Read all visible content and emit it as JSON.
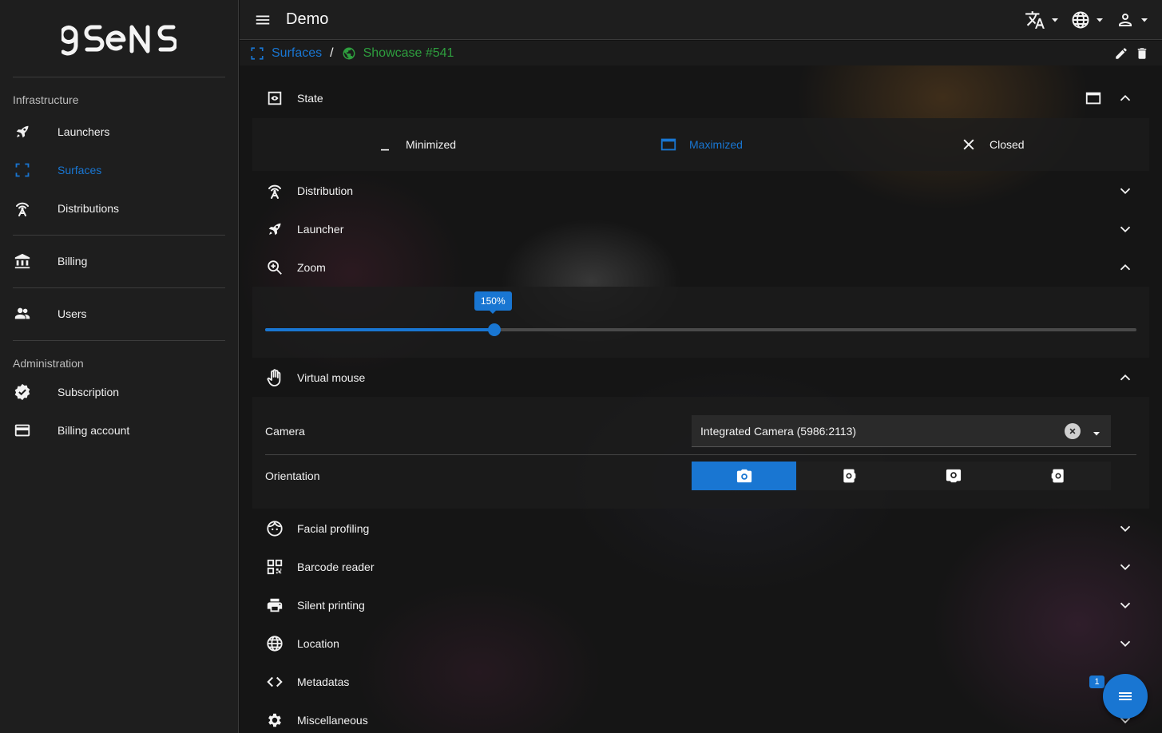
{
  "app": {
    "logo_text": "9sens",
    "title": "Demo"
  },
  "sidebar": {
    "sections": [
      {
        "label": "Infrastructure",
        "items": [
          {
            "label": "Launchers",
            "icon": "rocket-icon"
          },
          {
            "label": "Surfaces",
            "icon": "fullscreen-icon",
            "active": true
          },
          {
            "label": "Distributions",
            "icon": "antenna-icon"
          }
        ]
      }
    ],
    "items": {
      "launchers": "Launchers",
      "surfaces": "Surfaces",
      "distributions": "Distributions",
      "billing": "Billing",
      "users": "Users",
      "subscription": "Subscription",
      "billing_account": "Billing account"
    },
    "infrastructure_label": "Infrastructure",
    "administration_label": "Administration"
  },
  "breadcrumb": {
    "parent": "Surfaces",
    "separator": "/",
    "current": "Showcase #541"
  },
  "panels": {
    "state": "State",
    "distribution": "Distribution",
    "launcher": "Launcher",
    "zoom": "Zoom",
    "virtual_mouse": "Virtual mouse",
    "facial_profiling": "Facial profiling",
    "barcode_reader": "Barcode reader",
    "silent_printing": "Silent printing",
    "location": "Location",
    "metadatas": "Metadatas",
    "miscellaneous": "Miscellaneous"
  },
  "state_options": {
    "minimized": "Minimized",
    "maximized": "Maximized",
    "closed": "Closed",
    "selected": "Maximized"
  },
  "zoom": {
    "value_label": "150%",
    "fraction": 0.263
  },
  "virtual_mouse": {
    "camera_label": "Camera",
    "camera_value": "Integrated Camera (5986:2113)",
    "orientation_label": "Orientation",
    "orientation_selected_index": 0
  },
  "fab": {
    "badge": "1"
  },
  "colors": {
    "accent": "#1976d2",
    "success": "#2e9e3e",
    "sidebar_bg": "#1e1e1e"
  }
}
